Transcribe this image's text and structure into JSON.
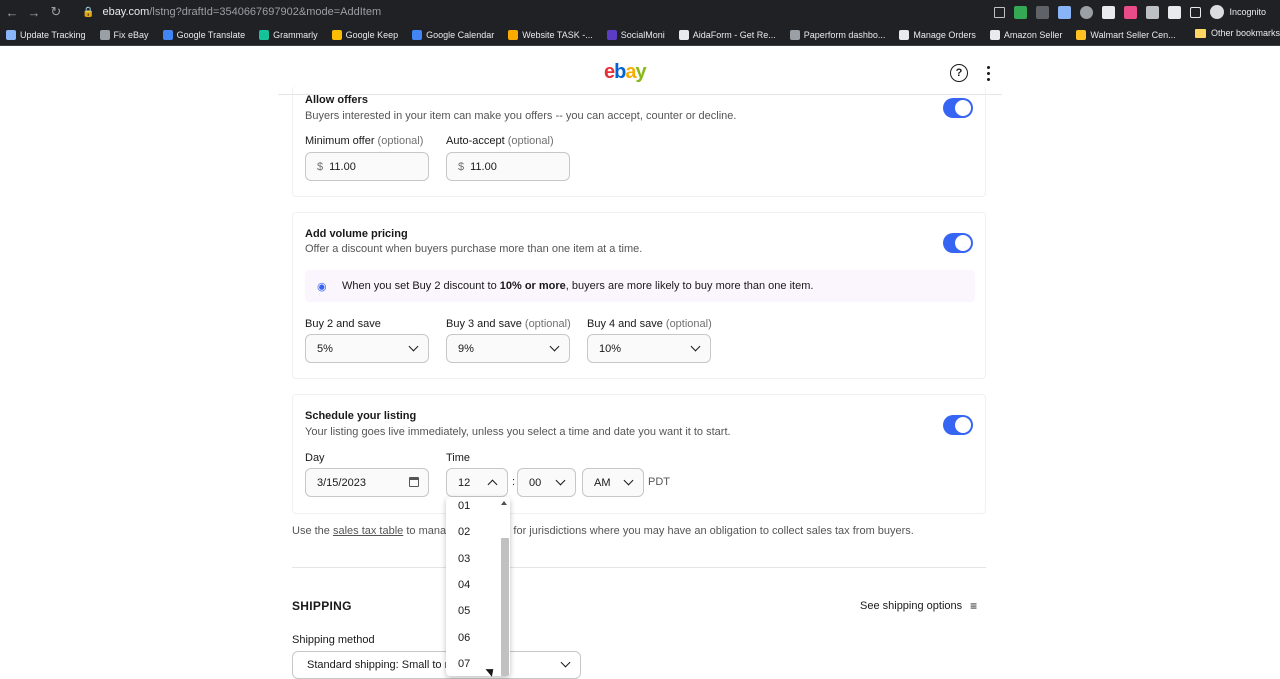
{
  "browser": {
    "url_host": "ebay.com",
    "url_path": "/lstng?draftId=3540667697902&mode=AddItem",
    "profile_label": "Incognito",
    "bookmarks": [
      {
        "label": "Update Tracking",
        "color": "#8ab4f8"
      },
      {
        "label": "Fix eBay",
        "color": "#9aa0a6"
      },
      {
        "label": "Google Translate",
        "color": "#4285f4"
      },
      {
        "label": "Grammarly",
        "color": "#15c39a"
      },
      {
        "label": "Google Keep",
        "color": "#fbbc04"
      },
      {
        "label": "Google Calendar",
        "color": "#4285f4"
      },
      {
        "label": "Website TASK -...",
        "color": "#f9ab00"
      },
      {
        "label": "SocialMoni",
        "color": "#5b3cc4"
      },
      {
        "label": "AidaForm - Get Re...",
        "color": "#e8eaed"
      },
      {
        "label": "Paperform dashbo...",
        "color": "#9aa0a6"
      },
      {
        "label": "Manage Orders",
        "color": "#e8eaed"
      },
      {
        "label": "Amazon Seller",
        "color": "#e8eaed"
      },
      {
        "label": "Walmart Seller Cen...",
        "color": "#ffc220"
      }
    ],
    "bookmarks_more": "»",
    "other_bookmarks": "Other bookmarks"
  },
  "header": {
    "logo": {
      "e": "e",
      "b": "b",
      "a": "a",
      "y": "y"
    },
    "help_glyph": "?"
  },
  "offers": {
    "title": "Allow offers",
    "description": "Buyers interested in your item can make you offers -- you can accept, counter or decline.",
    "min_offer_label": "Minimum offer",
    "min_offer_optional": "(optional)",
    "min_offer_currency": "$",
    "min_offer_value": "11.00",
    "auto_accept_label": "Auto-accept",
    "auto_accept_optional": "(optional)",
    "auto_accept_currency": "$",
    "auto_accept_value": "11.00",
    "enabled": true
  },
  "volume": {
    "title": "Add volume pricing",
    "description": "Offer a discount when buyers purchase more than one item at a time.",
    "tip_prefix": "When you set Buy 2 discount to ",
    "tip_bold": "10% or more",
    "tip_suffix": ", buyers are more likely to buy more than one item.",
    "buy2_label": "Buy 2 and save",
    "buy2_value": "5%",
    "buy3_label": "Buy 3 and save",
    "buy3_optional": "(optional)",
    "buy3_value": "9%",
    "buy4_label": "Buy 4 and save",
    "buy4_optional": "(optional)",
    "buy4_value": "10%",
    "enabled": true
  },
  "schedule": {
    "title": "Schedule your listing",
    "description": "Your listing goes live immediately, unless you select a time and date you want it to start.",
    "day_label": "Day",
    "day_value": "3/15/2023",
    "time_label": "Time",
    "hour_value": "12",
    "separator": ":",
    "minute_value": "00",
    "ampm_value": "AM",
    "timezone": "PDT",
    "enabled": true
  },
  "hour_dropdown": {
    "options": [
      "01",
      "02",
      "03",
      "04",
      "05",
      "06",
      "07"
    ]
  },
  "tax": {
    "prefix": "Use the ",
    "link": "sales tax table",
    "middle": " to manag",
    "suffix": "e for jurisdictions where you may have an obligation to collect sales tax from buyers."
  },
  "shipping": {
    "title": "SHIPPING",
    "see_options": "See shipping options",
    "method_label": "Shipping method",
    "method_value": "Standard shipping: Small to m"
  },
  "colors": {
    "accent": "#3665f3",
    "ebay_red": "#e53238",
    "ebay_blue": "#0064d2",
    "ebay_yellow": "#f5af02",
    "ebay_green": "#86b817"
  }
}
